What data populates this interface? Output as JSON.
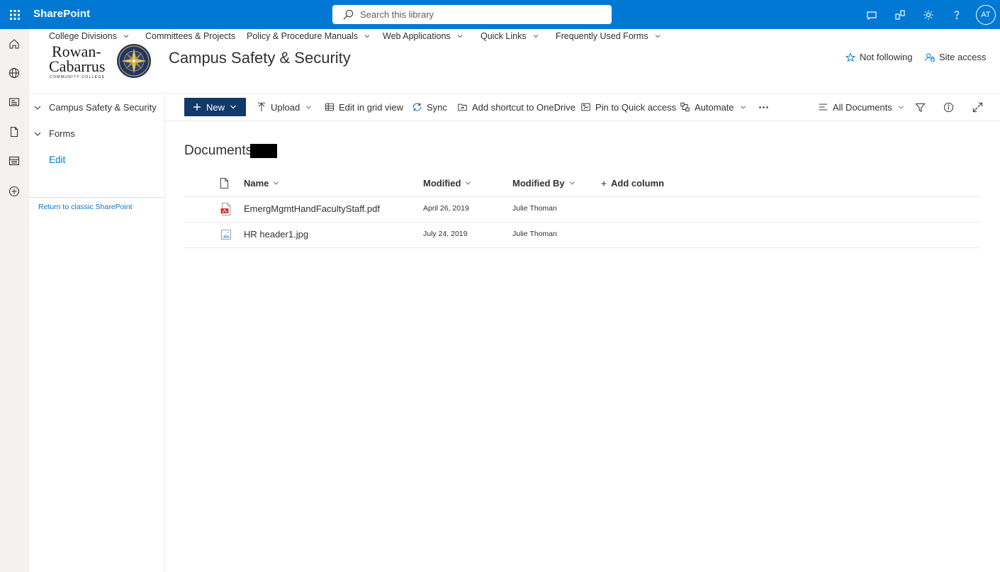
{
  "suitebar": {
    "app_name": "SharePoint",
    "search_placeholder": "Search this library",
    "avatar_initials": "AT",
    "background_color": "#0078d4"
  },
  "hub_nav": {
    "items": [
      {
        "label": "College Divisions",
        "has_dropdown": true
      },
      {
        "label": "Committees & Projects",
        "has_dropdown": false
      },
      {
        "label": "Policy & Procedure Manuals",
        "has_dropdown": true
      },
      {
        "label": "Web Applications",
        "has_dropdown": true
      },
      {
        "label": "Quick Links",
        "has_dropdown": true
      },
      {
        "label": "Frequently Used Forms",
        "has_dropdown": true
      }
    ]
  },
  "site": {
    "title": "Campus Safety & Security",
    "logo_text_line1": "Rowan-",
    "logo_text_line2": "Cabarrus",
    "logo_text_line3": "COMMUNITY COLLEGE",
    "follow_label": "Not following",
    "site_access_label": "Site access"
  },
  "left_nav": {
    "items": [
      {
        "label": "Campus Safety & Security"
      },
      {
        "label": "Forms"
      }
    ],
    "edit_label": "Edit",
    "return_classic_label": "Return to classic SharePoint"
  },
  "command_bar": {
    "new_label": "New",
    "upload_label": "Upload",
    "edit_grid_label": "Edit in grid view",
    "sync_label": "Sync",
    "shortcut_label": "Add shortcut to OneDrive",
    "pin_label": "Pin to Quick access",
    "automate_label": "Automate",
    "more_label": "⋯",
    "view_label": "All Documents"
  },
  "library": {
    "title": "Documents",
    "columns": {
      "name": "Name",
      "modified": "Modified",
      "modified_by": "Modified By",
      "add_column": "Add column"
    },
    "rows": [
      {
        "name": "EmergMgmtHandFacultyStaff.pdf",
        "modified": "April 26, 2019",
        "modified_by": "Julie Thoman",
        "icon": "pdf-file-icon"
      },
      {
        "name": "HR header1.jpg",
        "modified": "July 24, 2019",
        "modified_by": "Julie Thoman",
        "icon": "image-file-icon"
      }
    ]
  },
  "colors": {
    "accent": "#0078d4",
    "new_button": "#0f3a6b",
    "pdf_red": "#d13438"
  }
}
